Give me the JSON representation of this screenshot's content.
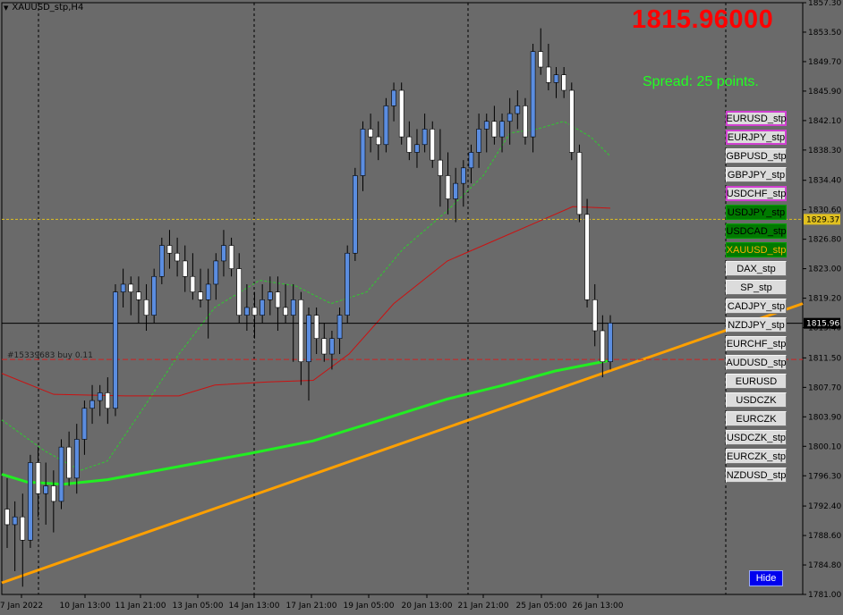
{
  "window": {
    "title": "XAUUSD_stp,H4"
  },
  "price_display": "1815.96000",
  "spread_text": "Spread: 25 points.",
  "order_label": "#15339683 buy 0.11",
  "price_tags": {
    "current": "1815.96",
    "bid_line": "1829.37"
  },
  "symbols": [
    {
      "label": "EURUSD_stp",
      "style": "magenta"
    },
    {
      "label": "EURJPY_stp",
      "style": "magenta"
    },
    {
      "label": "GBPUSD_stp",
      "style": "plain"
    },
    {
      "label": "GBPJPY_stp",
      "style": "plain"
    },
    {
      "label": "USDCHF_stp",
      "style": "magenta"
    },
    {
      "label": "USDJPY_stp",
      "style": "green"
    },
    {
      "label": "USDCAD_stp",
      "style": "green"
    },
    {
      "label": "XAUUSD_stp",
      "style": "green-orange"
    },
    {
      "label": "DAX_stp",
      "style": "plain"
    },
    {
      "label": "SP_stp",
      "style": "plain"
    },
    {
      "label": "CADJPY_stp",
      "style": "plain"
    },
    {
      "label": "NZDJPY_stp",
      "style": "plain"
    },
    {
      "label": "EURCHF_stp",
      "style": "plain"
    },
    {
      "label": "AUDUSD_stp",
      "style": "plain"
    },
    {
      "label": "EURUSD",
      "style": "plain"
    },
    {
      "label": "USDCZK",
      "style": "plain"
    },
    {
      "label": "EURCZK",
      "style": "plain"
    },
    {
      "label": "USDCZK_stp",
      "style": "plain"
    },
    {
      "label": "EURCZK_stp",
      "style": "plain"
    },
    {
      "label": "NZDUSD_stp",
      "style": "plain"
    }
  ],
  "hide_label": "Hide",
  "colors": {
    "bull": "#5b8de0",
    "bear": "#ffffff",
    "wick": "#000000",
    "ma_fast": "#2ecc2e",
    "ma_mid": "#cc1111",
    "ma_slow": "#22ee22",
    "trendline": "#ffa000",
    "bg": "#6a6a6a"
  },
  "chart_data": {
    "type": "candlestick",
    "symbol": "XAUUSD_stp",
    "timeframe": "H4",
    "ylim": [
      1781.0,
      1857.3
    ],
    "y_ticks": [
      "1857.30",
      "1853.50",
      "1849.70",
      "1845.90",
      "1842.10",
      "1838.30",
      "1834.40",
      "1830.60",
      "1826.80",
      "1823.00",
      "1819.20",
      "1815.40",
      "1811.50",
      "1807.70",
      "1803.90",
      "1800.10",
      "1796.30",
      "1792.40",
      "1788.60",
      "1784.80",
      "1781.00"
    ],
    "x_ticks": [
      "7 Jan 2022",
      "10 Jan 13:00",
      "11 Jan 21:00",
      "13 Jan 05:00",
      "14 Jan 13:00",
      "17 Jan 21:00",
      "19 Jan 05:00",
      "20 Jan 13:00",
      "21 Jan 21:00",
      "25 Jan 05:00",
      "26 Jan 13:00"
    ],
    "current_price": 1815.96,
    "bid_line": 1829.37,
    "order_price": 1811.3,
    "candles": [
      [
        1792,
        1796,
        1787,
        1790
      ],
      [
        1790,
        1793,
        1784,
        1791
      ],
      [
        1791,
        1794,
        1782,
        1788
      ],
      [
        1788,
        1799,
        1787,
        1798
      ],
      [
        1798,
        1800,
        1791,
        1794
      ],
      [
        1794,
        1798,
        1790,
        1795
      ],
      [
        1795,
        1797,
        1789,
        1793
      ],
      [
        1793,
        1801,
        1792,
        1800
      ],
      [
        1800,
        1802,
        1795,
        1796
      ],
      [
        1796,
        1803,
        1794,
        1801
      ],
      [
        1801,
        1806,
        1799,
        1805
      ],
      [
        1805,
        1808,
        1803,
        1806
      ],
      [
        1806,
        1808,
        1804,
        1807
      ],
      [
        1807,
        1809,
        1803,
        1805
      ],
      [
        1805,
        1821,
        1804,
        1820
      ],
      [
        1820,
        1823,
        1818,
        1821
      ],
      [
        1821,
        1822,
        1817,
        1820
      ],
      [
        1820,
        1822,
        1816,
        1819
      ],
      [
        1819,
        1821,
        1815,
        1817
      ],
      [
        1817,
        1823,
        1816,
        1822
      ],
      [
        1822,
        1827,
        1821,
        1826
      ],
      [
        1826,
        1828,
        1823,
        1825
      ],
      [
        1825,
        1827,
        1822,
        1824
      ],
      [
        1824,
        1826,
        1820,
        1822
      ],
      [
        1822,
        1825,
        1819,
        1820
      ],
      [
        1820,
        1823,
        1818,
        1819
      ],
      [
        1819,
        1823,
        1814,
        1821
      ],
      [
        1821,
        1825,
        1819,
        1824
      ],
      [
        1824,
        1828,
        1822,
        1826
      ],
      [
        1826,
        1827,
        1822,
        1823
      ],
      [
        1823,
        1825,
        1816,
        1817
      ],
      [
        1817,
        1821,
        1815,
        1818
      ],
      [
        1818,
        1820,
        1814,
        1817
      ],
      [
        1817,
        1821,
        1816,
        1819
      ],
      [
        1819,
        1822,
        1817,
        1820
      ],
      [
        1820,
        1822,
        1815,
        1818
      ],
      [
        1818,
        1821,
        1816,
        1817
      ],
      [
        1817,
        1821,
        1811,
        1819
      ],
      [
        1819,
        1820,
        1808,
        1811
      ],
      [
        1811,
        1818,
        1806,
        1817
      ],
      [
        1817,
        1818,
        1812,
        1814
      ],
      [
        1814,
        1816,
        1811,
        1812
      ],
      [
        1812,
        1815,
        1810,
        1814
      ],
      [
        1814,
        1818,
        1812,
        1817
      ],
      [
        1817,
        1826,
        1816,
        1825
      ],
      [
        1825,
        1836,
        1824,
        1835
      ],
      [
        1835,
        1842,
        1833,
        1841
      ],
      [
        1841,
        1843,
        1838,
        1840
      ],
      [
        1840,
        1842,
        1837,
        1839
      ],
      [
        1839,
        1845,
        1838,
        1844
      ],
      [
        1844,
        1847,
        1842,
        1846
      ],
      [
        1846,
        1847,
        1839,
        1840
      ],
      [
        1840,
        1842,
        1837,
        1838
      ],
      [
        1838,
        1841,
        1836,
        1839
      ],
      [
        1839,
        1843,
        1838,
        1841
      ],
      [
        1841,
        1842,
        1836,
        1837
      ],
      [
        1837,
        1841,
        1831,
        1835
      ],
      [
        1835,
        1838,
        1830,
        1832
      ],
      [
        1832,
        1836,
        1829,
        1834
      ],
      [
        1834,
        1837,
        1831,
        1836
      ],
      [
        1836,
        1839,
        1834,
        1838
      ],
      [
        1838,
        1843,
        1836,
        1841
      ],
      [
        1841,
        1843,
        1838,
        1842
      ],
      [
        1842,
        1844,
        1839,
        1840
      ],
      [
        1840,
        1843,
        1838,
        1842
      ],
      [
        1842,
        1845,
        1839,
        1843
      ],
      [
        1843,
        1846,
        1841,
        1844
      ],
      [
        1844,
        1845,
        1839,
        1840
      ],
      [
        1840,
        1852,
        1838,
        1851
      ],
      [
        1851,
        1854,
        1848,
        1849
      ],
      [
        1849,
        1852,
        1846,
        1847
      ],
      [
        1847,
        1849,
        1845,
        1848
      ],
      [
        1848,
        1849,
        1845,
        1846
      ],
      [
        1846,
        1847,
        1837,
        1838
      ],
      [
        1838,
        1839,
        1829,
        1830
      ],
      [
        1830,
        1832,
        1818,
        1819
      ],
      [
        1819,
        1821,
        1813,
        1815
      ],
      [
        1815,
        1817,
        1809,
        1811
      ],
      [
        1811,
        1817,
        1810,
        1816
      ]
    ]
  }
}
